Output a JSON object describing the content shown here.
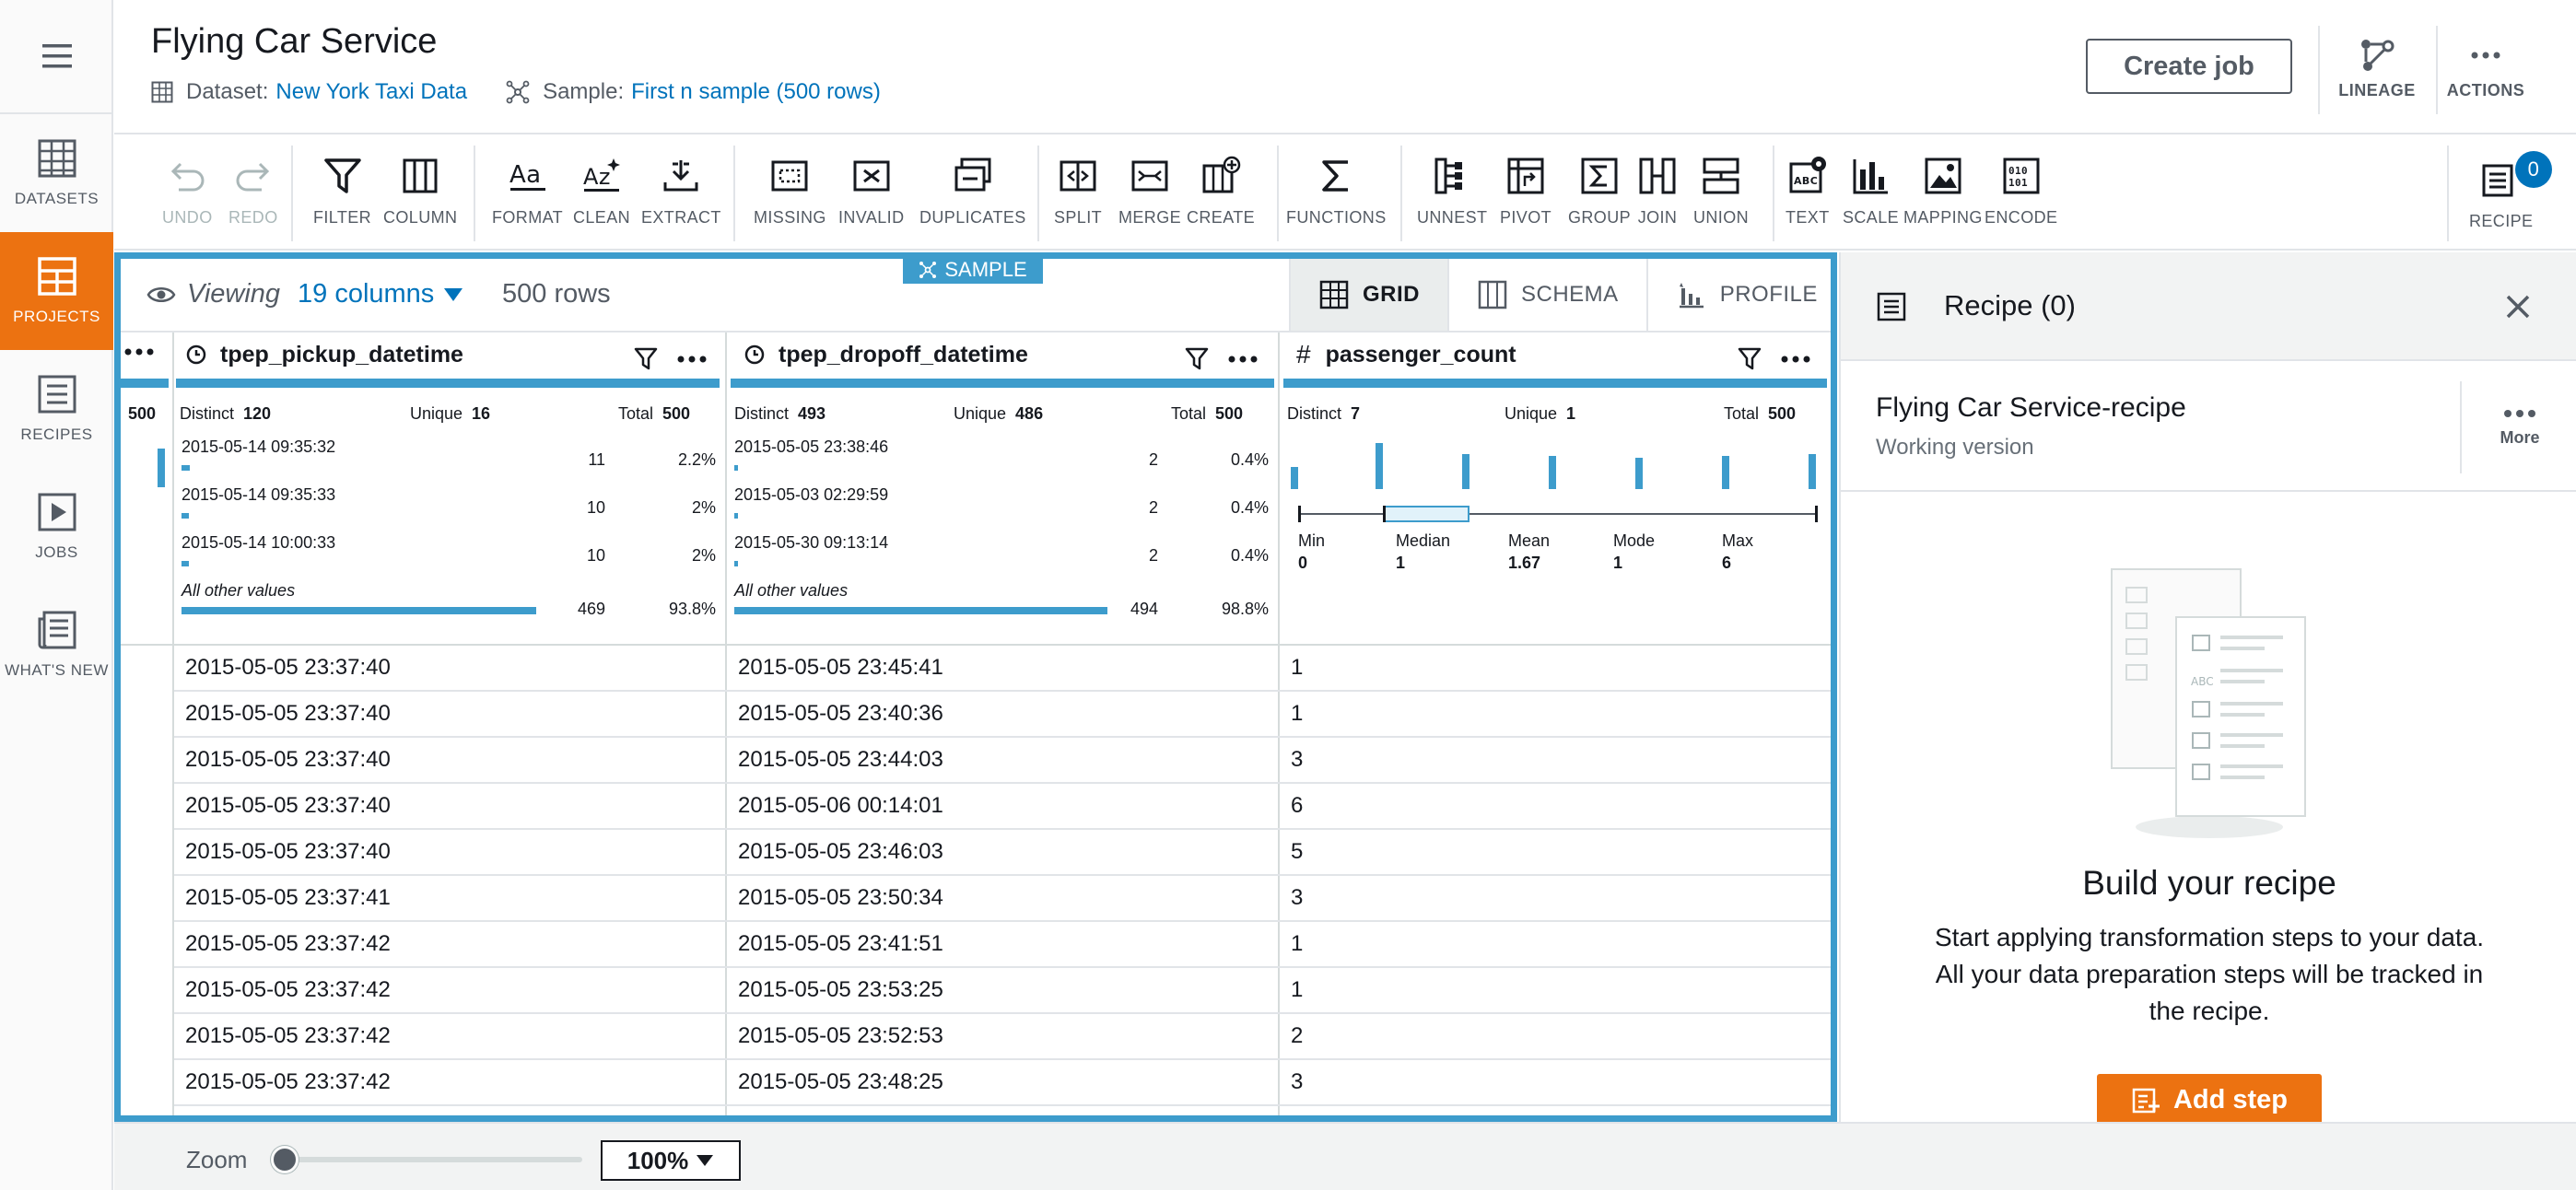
{
  "nav": {
    "items": [
      {
        "label": "DATASETS",
        "icon": "datasets-icon"
      },
      {
        "label": "PROJECTS",
        "icon": "projects-icon",
        "active": true
      },
      {
        "label": "RECIPES",
        "icon": "recipes-icon"
      },
      {
        "label": "JOBS",
        "icon": "jobs-icon"
      },
      {
        "label": "WHAT'S NEW",
        "icon": "whats-new-icon"
      }
    ]
  },
  "header": {
    "title": "Flying Car Service",
    "dataset_label": "Dataset:",
    "dataset_value": "New York Taxi Data",
    "sample_label": "Sample:",
    "sample_value": "First n sample (500 rows)",
    "create_job": "Create job",
    "lineage": "LINEAGE",
    "actions": "ACTIONS"
  },
  "toolbar": {
    "undo": "UNDO",
    "redo": "REDO",
    "filter": "FILTER",
    "column": "COLUMN",
    "format": "FORMAT",
    "clean": "CLEAN",
    "extract": "EXTRACT",
    "missing": "MISSING",
    "invalid": "INVALID",
    "duplicates": "DUPLICATES",
    "split": "SPLIT",
    "merge": "MERGE",
    "create": "CREATE",
    "functions": "FUNCTIONS",
    "unnest": "UNNEST",
    "pivot": "PIVOT",
    "group": "GROUP",
    "join": "JOIN",
    "union": "UNION",
    "text": "TEXT",
    "scale": "SCALE",
    "mapping": "MAPPING",
    "encode": "ENCODE",
    "recipe": "RECIPE",
    "recipe_count": "0"
  },
  "grid": {
    "sample_tag": "SAMPLE",
    "viewing_label": "Viewing",
    "columns_label": "19 columns",
    "rows_label": "500 rows",
    "tabs": {
      "grid": "GRID",
      "schema": "SCHEMA",
      "profile": "PROFILE"
    },
    "partial_col_total": "500",
    "columns": [
      {
        "name": "tpep_pickup_datetime",
        "distinct_label": "Distinct",
        "distinct": "120",
        "unique_label": "Unique",
        "unique": "16",
        "total_label": "Total",
        "total": "500",
        "top_values": [
          {
            "value": "2015-05-14 09:35:32",
            "count": "11",
            "pct": "2.2%",
            "share": 0.022
          },
          {
            "value": "2015-05-14 09:35:33",
            "count": "10",
            "pct": "2%",
            "share": 0.02
          },
          {
            "value": "2015-05-14 10:00:33",
            "count": "10",
            "pct": "2%",
            "share": 0.02
          }
        ],
        "other_label": "All other values",
        "other_count": "469",
        "other_pct": "93.8%",
        "other_share": 0.938
      },
      {
        "name": "tpep_dropoff_datetime",
        "distinct_label": "Distinct",
        "distinct": "493",
        "unique_label": "Unique",
        "unique": "486",
        "total_label": "Total",
        "total": "500",
        "top_values": [
          {
            "value": "2015-05-05 23:38:46",
            "count": "2",
            "pct": "0.4%",
            "share": 0.004
          },
          {
            "value": "2015-05-03 02:29:59",
            "count": "2",
            "pct": "0.4%",
            "share": 0.004
          },
          {
            "value": "2015-05-30 09:13:14",
            "count": "2",
            "pct": "0.4%",
            "share": 0.004
          }
        ],
        "other_label": "All other values",
        "other_count": "494",
        "other_pct": "98.8%",
        "other_share": 0.988
      },
      {
        "name": "passenger_count",
        "distinct_label": "Distinct",
        "distinct": "7",
        "unique_label": "Unique",
        "unique": "1",
        "total_label": "Total",
        "total": "500",
        "stats": [
          {
            "label": "Min",
            "value": "0"
          },
          {
            "label": "Median",
            "value": "1"
          },
          {
            "label": "Mean",
            "value": "1.67"
          },
          {
            "label": "Mode",
            "value": "1"
          },
          {
            "label": "Max",
            "value": "6"
          }
        ]
      }
    ],
    "rows": [
      [
        "2015-05-05 23:37:40",
        "2015-05-05 23:45:41",
        "1"
      ],
      [
        "2015-05-05 23:37:40",
        "2015-05-05 23:40:36",
        "1"
      ],
      [
        "2015-05-05 23:37:40",
        "2015-05-05 23:44:03",
        "3"
      ],
      [
        "2015-05-05 23:37:40",
        "2015-05-06 00:14:01",
        "6"
      ],
      [
        "2015-05-05 23:37:40",
        "2015-05-05 23:46:03",
        "5"
      ],
      [
        "2015-05-05 23:37:41",
        "2015-05-05 23:50:34",
        "3"
      ],
      [
        "2015-05-05 23:37:42",
        "2015-05-05 23:41:51",
        "1"
      ],
      [
        "2015-05-05 23:37:42",
        "2015-05-05 23:53:25",
        "1"
      ],
      [
        "2015-05-05 23:37:42",
        "2015-05-05 23:52:53",
        "2"
      ],
      [
        "2015-05-05 23:37:42",
        "2015-05-05 23:48:25",
        "3"
      ]
    ]
  },
  "recipe_panel": {
    "title": "Recipe (0)",
    "recipe_name": "Flying Car Service-recipe",
    "version": "Working version",
    "more": "More",
    "build_title": "Build your recipe",
    "build_desc": "Start applying transformation steps to your data. All your data preparation steps will be tracked in the recipe.",
    "add_step": "Add step"
  },
  "footer": {
    "zoom_label": "Zoom",
    "zoom_value": "100%",
    "zoom_level": 0
  },
  "colors": {
    "accent": "#ec7211",
    "link": "#0073bb",
    "selection": "#3d9ccc"
  }
}
